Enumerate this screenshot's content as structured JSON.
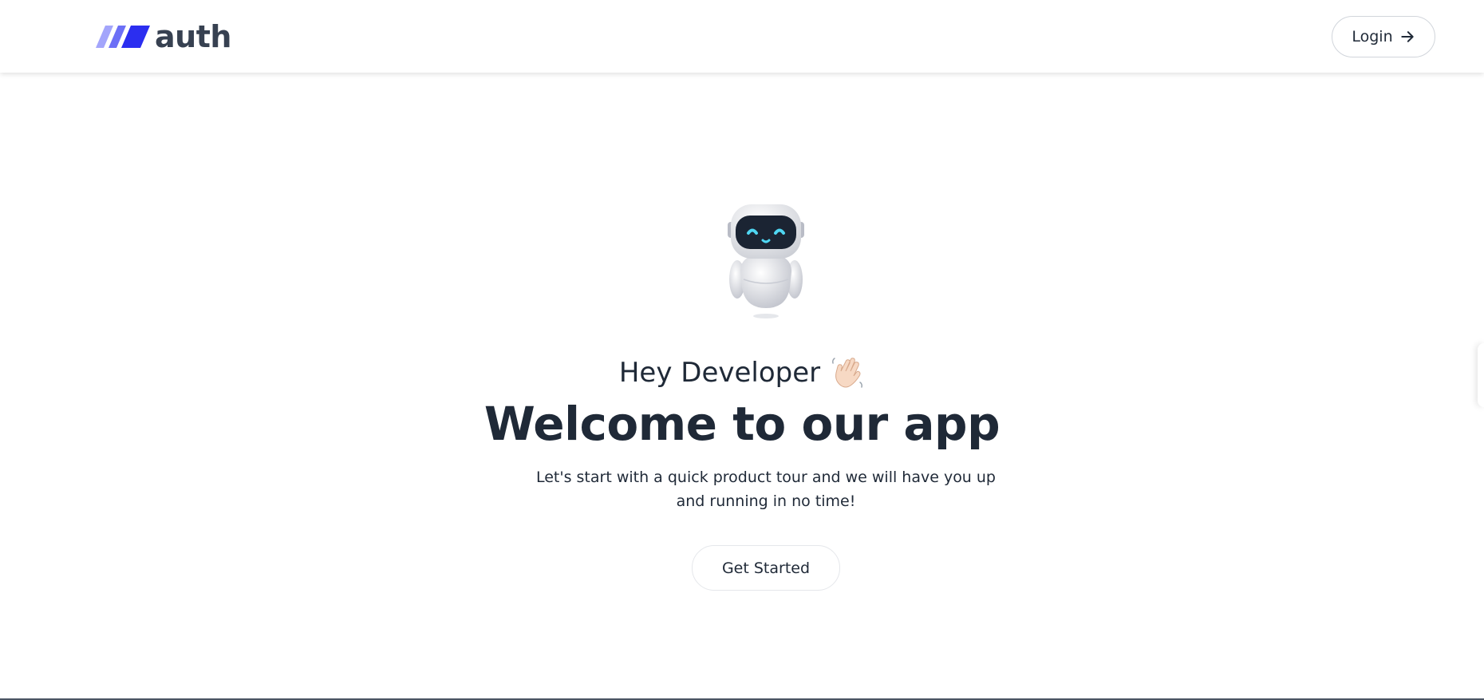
{
  "header": {
    "logo_text": "auth",
    "login_label": "Login"
  },
  "hero": {
    "greeting": "Hey Developer",
    "title": "Welcome to our app",
    "subtitle": "Let's start with a quick product tour and we will have you up and running in no time!",
    "cta_label": "Get Started"
  },
  "icons": {
    "logo": "logo-slashes-icon",
    "login_arrow": "arrow-right-icon",
    "mascot": "robot-icon",
    "greeting": "waving-hand-icon"
  },
  "colors": {
    "logo_gradient_start": "#9a9dfb",
    "logo_gradient_end": "#2a2cf0",
    "text_dark": "#1f2937",
    "logo_text": "#374151",
    "border": "#d1d5db"
  }
}
